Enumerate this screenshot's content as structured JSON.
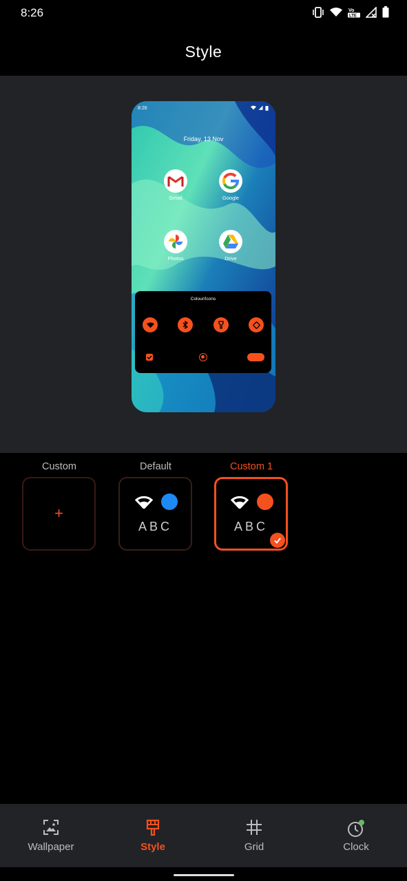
{
  "status_bar": {
    "time": "8:26"
  },
  "app_bar": {
    "title": "Style"
  },
  "preview": {
    "time": "8:26",
    "date": "Friday, 13 Nov",
    "apps": [
      {
        "label": "Gmail",
        "icon": "gmail-icon"
      },
      {
        "label": "Google",
        "icon": "google-icon"
      },
      {
        "label": "Photos",
        "icon": "photos-icon"
      },
      {
        "label": "Drive",
        "icon": "drive-icon"
      }
    ],
    "panel_title": "Colour/Icons"
  },
  "options": [
    {
      "label": "Custom",
      "type": "add"
    },
    {
      "label": "Default",
      "type": "style",
      "accent": "#1e88f4",
      "text": "ABC"
    },
    {
      "label": "Custom 1",
      "type": "style",
      "accent": "#f4511e",
      "text": "ABC",
      "selected": true
    }
  ],
  "bottom_nav": {
    "items": [
      {
        "label": "Wallpaper",
        "icon": "wallpaper-icon"
      },
      {
        "label": "Style",
        "icon": "style-icon",
        "active": true
      },
      {
        "label": "Grid",
        "icon": "grid-icon"
      },
      {
        "label": "Clock",
        "icon": "clock-icon"
      }
    ]
  },
  "colors": {
    "accent": "#f4511e",
    "default_accent": "#1e88f4",
    "surface": "#222326"
  }
}
